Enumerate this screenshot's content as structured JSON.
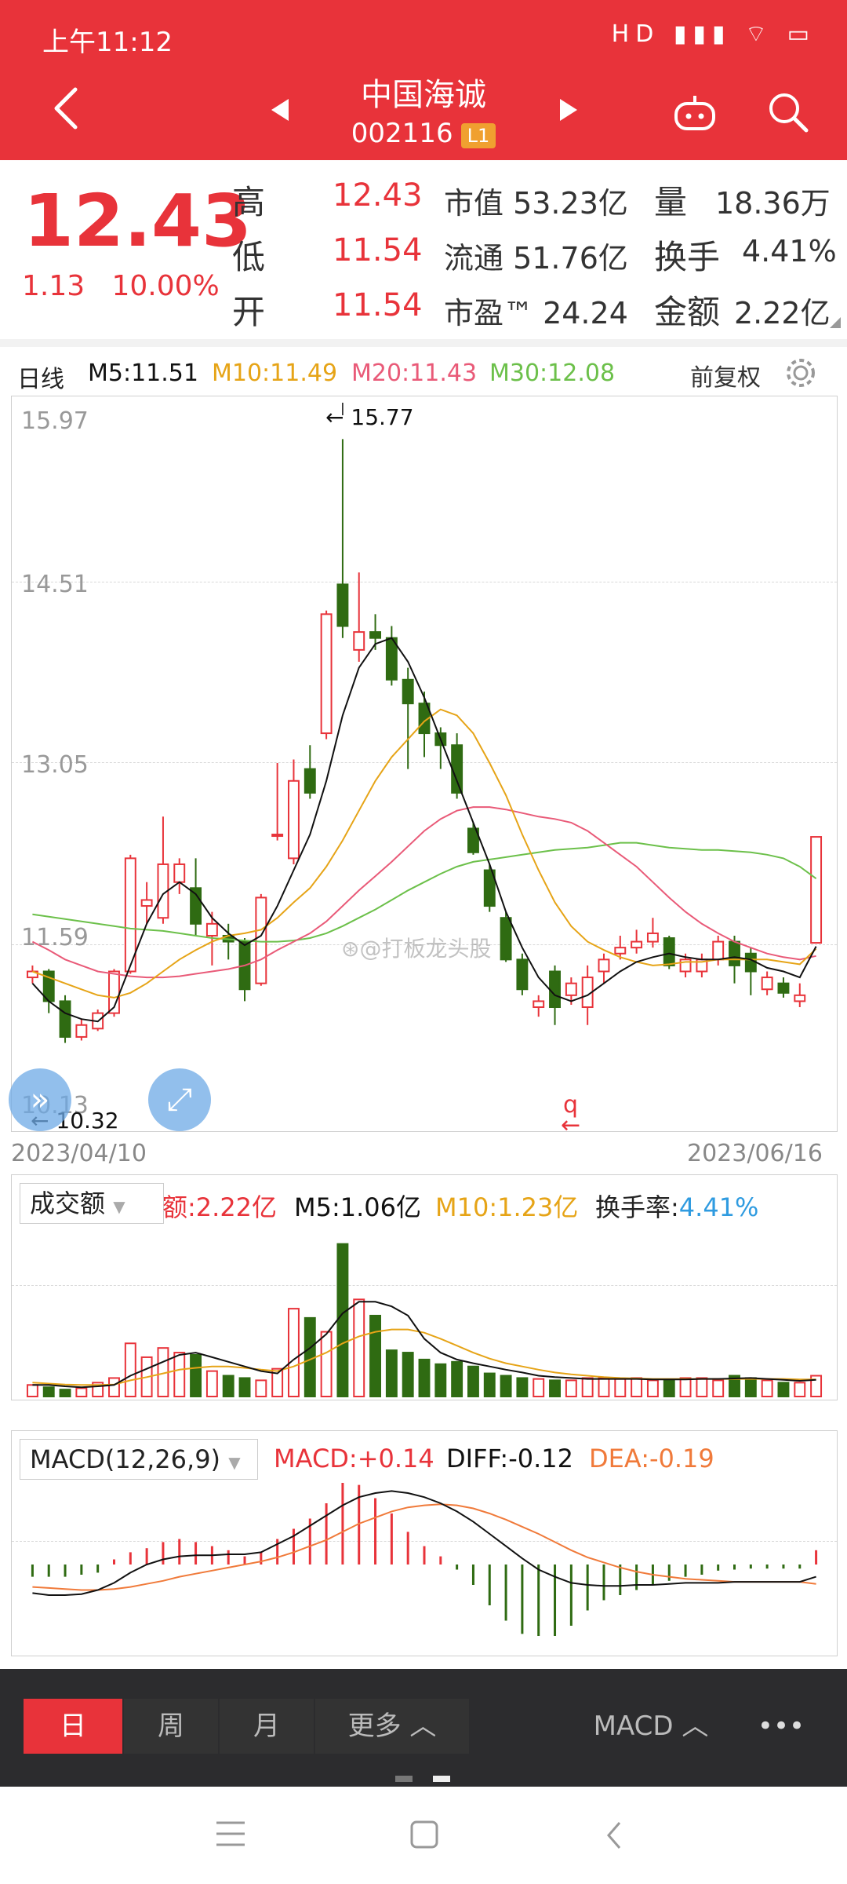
{
  "status": {
    "time": "上午11:12",
    "icons": "HD ▮▮▮ ⌔ ▭"
  },
  "header": {
    "title": "中国海诚",
    "code": "002116",
    "level": "L1"
  },
  "quote": {
    "price": "12.43",
    "change": "1.13",
    "change_pct": "10.00%",
    "high_label": "高",
    "high": "12.43",
    "low_label": "低",
    "low": "11.54",
    "open_label": "开",
    "open": "11.54",
    "mktcap": "市值 53.23亿",
    "float": "流通 51.76亿",
    "pe": "市盈™ 24.24",
    "vol_label": "量",
    "vol": "18.36万",
    "turnover_label": "换手",
    "turnover": "4.41%",
    "amount_label": "金额",
    "amount": "2.22亿"
  },
  "kline_legend": {
    "period": "日线",
    "m5": "M5:11.51",
    "m10": "M10:11.49",
    "m20": "M20:11.43",
    "m30": "M30:12.08",
    "adjust": "前复权"
  },
  "kline_axis": {
    "ticks": [
      "15.97",
      "14.51",
      "13.05",
      "11.59",
      "10.13"
    ],
    "date_start": "2023/04/10",
    "date_end": "2023/06/16",
    "max_label": "15.77",
    "min_label": "10.32",
    "marker": "q"
  },
  "watermark": "@打板龙头股",
  "volume_legend": {
    "selector": "成交额",
    "amount": "额:2.22亿",
    "m5": "M5:1.06亿",
    "m10": "M10:1.23亿",
    "turn_label": "换手率:",
    "turn_value": "4.41%"
  },
  "macd_legend": {
    "selector": "MACD(12,26,9)",
    "macd": "MACD:+0.14",
    "diff": "DIFF:-0.12",
    "dea": "DEA:-0.19"
  },
  "tabs": {
    "day": "日",
    "week": "周",
    "month": "月",
    "more": "更多 ︿",
    "indicator": "MACD ︿",
    "dots": "•••"
  },
  "colors": {
    "up": "#e8333a",
    "down": "#2f6b12",
    "m5": "#111111",
    "m10": "#e6a417",
    "m20": "#e95a78",
    "m30": "#6cc04a",
    "header": "#e8333a",
    "diff": "#111111",
    "dea": "#f07a3a"
  },
  "chart_data": {
    "type": "candlestick",
    "x_start": "2023/04/10",
    "x_end": "2023/06/16",
    "ylim": [
      10.13,
      15.97
    ],
    "candles": [
      [
        11.25,
        11.3,
        11.35,
        11.2
      ],
      [
        11.3,
        11.05,
        11.32,
        10.95
      ],
      [
        11.05,
        10.75,
        11.1,
        10.7
      ],
      [
        10.75,
        10.85,
        10.9,
        10.72
      ],
      [
        10.82,
        10.95,
        10.98,
        10.8
      ],
      [
        10.95,
        11.3,
        11.32,
        10.92
      ],
      [
        11.3,
        12.25,
        12.28,
        11.28
      ],
      [
        11.85,
        11.9,
        12.05,
        11.7
      ],
      [
        11.75,
        12.2,
        12.6,
        11.7
      ],
      [
        12.05,
        12.2,
        12.25,
        11.95
      ],
      [
        12.0,
        11.7,
        12.25,
        11.6
      ],
      [
        11.6,
        11.7,
        11.8,
        11.35
      ],
      [
        11.6,
        11.55,
        11.7,
        11.4
      ],
      [
        11.55,
        11.15,
        11.58,
        11.05
      ],
      [
        11.2,
        11.92,
        11.95,
        11.18
      ],
      [
        12.45,
        12.45,
        13.05,
        12.4
      ],
      [
        12.25,
        12.9,
        13.08,
        12.2
      ],
      [
        13.0,
        12.8,
        13.2,
        12.75
      ],
      [
        13.3,
        14.3,
        14.33,
        13.25
      ],
      [
        14.55,
        14.2,
        15.77,
        14.1
      ],
      [
        14.0,
        14.15,
        14.65,
        13.9
      ],
      [
        14.15,
        14.1,
        14.3,
        14.0
      ],
      [
        14.1,
        13.75,
        14.2,
        13.7
      ],
      [
        13.75,
        13.55,
        13.85,
        13.0
      ],
      [
        13.55,
        13.3,
        13.65,
        13.1
      ],
      [
        13.3,
        13.2,
        13.35,
        13.0
      ],
      [
        13.2,
        12.8,
        13.3,
        12.75
      ],
      [
        12.5,
        12.3,
        12.55,
        12.28
      ],
      [
        12.15,
        11.85,
        12.2,
        11.8
      ],
      [
        11.75,
        11.4,
        11.8,
        11.38
      ],
      [
        11.4,
        11.15,
        11.45,
        11.1
      ],
      [
        11.0,
        11.05,
        11.1,
        10.92
      ],
      [
        11.3,
        11.0,
        11.35,
        10.85
      ],
      [
        11.1,
        11.2,
        11.25,
        11.02
      ],
      [
        11.0,
        11.25,
        11.35,
        10.85
      ],
      [
        11.3,
        11.4,
        11.45,
        11.2
      ],
      [
        11.45,
        11.5,
        11.6,
        11.4
      ],
      [
        11.5,
        11.55,
        11.65,
        11.45
      ],
      [
        11.55,
        11.62,
        11.75,
        11.5
      ],
      [
        11.58,
        11.35,
        11.6,
        11.32
      ],
      [
        11.3,
        11.4,
        11.45,
        11.25
      ],
      [
        11.3,
        11.4,
        11.45,
        11.25
      ],
      [
        11.4,
        11.55,
        11.6,
        11.35
      ],
      [
        11.55,
        11.35,
        11.6,
        11.2
      ],
      [
        11.45,
        11.3,
        11.5,
        11.1
      ],
      [
        11.15,
        11.25,
        11.3,
        11.1
      ],
      [
        11.2,
        11.12,
        11.25,
        11.08
      ],
      [
        11.05,
        11.1,
        11.2,
        11.0
      ],
      [
        11.54,
        12.43,
        12.43,
        11.54
      ]
    ],
    "ma5": [
      11.2,
      11.05,
      10.95,
      10.9,
      10.88,
      11.0,
      11.35,
      11.7,
      11.95,
      12.05,
      11.95,
      11.75,
      11.62,
      11.52,
      11.6,
      11.85,
      12.15,
      12.45,
      12.9,
      13.45,
      13.85,
      14.05,
      14.1,
      13.9,
      13.6,
      13.25,
      12.9,
      12.55,
      12.2,
      11.8,
      11.5,
      11.25,
      11.1,
      11.05,
      11.1,
      11.2,
      11.3,
      11.38,
      11.42,
      11.45,
      11.42,
      11.4,
      11.4,
      11.42,
      11.4,
      11.33,
      11.3,
      11.25,
      11.51
    ],
    "ma10": [
      11.3,
      11.25,
      11.2,
      11.15,
      11.1,
      11.08,
      11.12,
      11.2,
      11.3,
      11.4,
      11.48,
      11.55,
      11.6,
      11.62,
      11.65,
      11.75,
      11.88,
      12.0,
      12.18,
      12.4,
      12.65,
      12.9,
      13.1,
      13.25,
      13.4,
      13.5,
      13.45,
      13.3,
      13.05,
      12.78,
      12.45,
      12.15,
      11.88,
      11.68,
      11.55,
      11.48,
      11.42,
      11.38,
      11.35,
      11.36,
      11.38,
      11.38,
      11.4,
      11.4,
      11.4,
      11.4,
      11.38,
      11.36,
      11.49
    ],
    "ma20": [
      11.55,
      11.48,
      11.4,
      11.35,
      11.3,
      11.28,
      11.26,
      11.25,
      11.25,
      11.26,
      11.28,
      11.3,
      11.32,
      11.35,
      11.4,
      11.48,
      11.55,
      11.62,
      11.72,
      11.85,
      11.98,
      12.1,
      12.22,
      12.35,
      12.48,
      12.58,
      12.65,
      12.68,
      12.68,
      12.66,
      12.63,
      12.6,
      12.58,
      12.55,
      12.48,
      12.38,
      12.28,
      12.18,
      12.05,
      11.92,
      11.8,
      11.7,
      11.62,
      11.55,
      11.5,
      11.45,
      11.42,
      11.4,
      11.43
    ],
    "ma30": [
      11.78,
      11.76,
      11.74,
      11.72,
      11.7,
      11.68,
      11.66,
      11.65,
      11.64,
      11.62,
      11.6,
      11.58,
      11.57,
      11.56,
      11.55,
      11.55,
      11.56,
      11.58,
      11.62,
      11.68,
      11.75,
      11.82,
      11.9,
      11.98,
      12.05,
      12.12,
      12.18,
      12.22,
      12.24,
      12.26,
      12.28,
      12.3,
      12.32,
      12.33,
      12.34,
      12.36,
      12.38,
      12.38,
      12.36,
      12.34,
      12.33,
      12.32,
      12.32,
      12.31,
      12.3,
      12.28,
      12.25,
      12.18,
      12.08
    ],
    "volume": [
      0.25,
      0.2,
      0.15,
      0.18,
      0.3,
      0.4,
      1.15,
      0.85,
      1.05,
      0.95,
      0.9,
      0.55,
      0.45,
      0.4,
      0.35,
      0.6,
      1.9,
      1.7,
      1.4,
      3.3,
      2.1,
      1.75,
      1.0,
      0.95,
      0.8,
      0.7,
      0.75,
      0.65,
      0.5,
      0.45,
      0.4,
      0.38,
      0.35,
      0.35,
      0.4,
      0.4,
      0.38,
      0.4,
      0.35,
      0.35,
      0.4,
      0.4,
      0.35,
      0.45,
      0.4,
      0.35,
      0.3,
      0.3,
      0.45
    ],
    "vol_ma5": [
      0.25,
      0.25,
      0.22,
      0.2,
      0.22,
      0.25,
      0.45,
      0.6,
      0.75,
      0.9,
      0.95,
      0.85,
      0.75,
      0.65,
      0.55,
      0.5,
      0.8,
      1.05,
      1.35,
      1.8,
      2.05,
      2.05,
      1.95,
      1.75,
      1.25,
      0.95,
      0.8,
      0.72,
      0.65,
      0.58,
      0.52,
      0.45,
      0.42,
      0.4,
      0.38,
      0.38,
      0.38,
      0.38,
      0.37,
      0.37,
      0.37,
      0.38,
      0.38,
      0.39,
      0.4,
      0.38,
      0.36,
      0.34,
      0.36
    ],
    "vol_ma10": [
      0.3,
      0.28,
      0.26,
      0.25,
      0.25,
      0.26,
      0.35,
      0.42,
      0.5,
      0.58,
      0.62,
      0.65,
      0.65,
      0.62,
      0.58,
      0.55,
      0.65,
      0.8,
      0.95,
      1.15,
      1.3,
      1.4,
      1.45,
      1.45,
      1.38,
      1.25,
      1.1,
      0.95,
      0.82,
      0.72,
      0.65,
      0.58,
      0.52,
      0.48,
      0.45,
      0.42,
      0.4,
      0.39,
      0.38,
      0.38,
      0.38,
      0.38,
      0.38,
      0.38,
      0.38,
      0.38,
      0.38,
      0.37,
      0.37
    ],
    "macd_hist": [
      -0.12,
      -0.12,
      -0.12,
      -0.1,
      -0.08,
      0.05,
      0.12,
      0.16,
      0.22,
      0.25,
      0.22,
      0.18,
      0.14,
      0.08,
      0.12,
      0.25,
      0.35,
      0.45,
      0.6,
      0.8,
      0.78,
      0.65,
      0.5,
      0.32,
      0.18,
      0.08,
      -0.05,
      -0.2,
      -0.4,
      -0.55,
      -0.68,
      -0.7,
      -0.7,
      -0.6,
      -0.45,
      -0.35,
      -0.3,
      -0.25,
      -0.2,
      -0.16,
      -0.12,
      -0.1,
      -0.06,
      -0.05,
      -0.04,
      -0.04,
      -0.04,
      -0.04,
      0.14
    ],
    "diff": [
      -0.28,
      -0.3,
      -0.3,
      -0.29,
      -0.25,
      -0.18,
      -0.08,
      0.0,
      0.05,
      0.08,
      0.09,
      0.09,
      0.1,
      0.1,
      0.12,
      0.2,
      0.28,
      0.38,
      0.48,
      0.58,
      0.66,
      0.7,
      0.72,
      0.7,
      0.66,
      0.6,
      0.52,
      0.42,
      0.3,
      0.18,
      0.06,
      -0.05,
      -0.12,
      -0.18,
      -0.2,
      -0.21,
      -0.21,
      -0.2,
      -0.2,
      -0.19,
      -0.18,
      -0.18,
      -0.18,
      -0.17,
      -0.17,
      -0.17,
      -0.17,
      -0.17,
      -0.12
    ],
    "dea": [
      -0.22,
      -0.23,
      -0.24,
      -0.25,
      -0.25,
      -0.24,
      -0.22,
      -0.19,
      -0.16,
      -0.12,
      -0.09,
      -0.06,
      -0.03,
      0.0,
      0.03,
      0.07,
      0.12,
      0.18,
      0.24,
      0.32,
      0.4,
      0.46,
      0.52,
      0.56,
      0.58,
      0.59,
      0.58,
      0.55,
      0.5,
      0.44,
      0.37,
      0.3,
      0.22,
      0.14,
      0.07,
      0.02,
      -0.03,
      -0.07,
      -0.1,
      -0.12,
      -0.14,
      -0.15,
      -0.16,
      -0.17,
      -0.17,
      -0.17,
      -0.17,
      -0.17,
      -0.19
    ]
  }
}
